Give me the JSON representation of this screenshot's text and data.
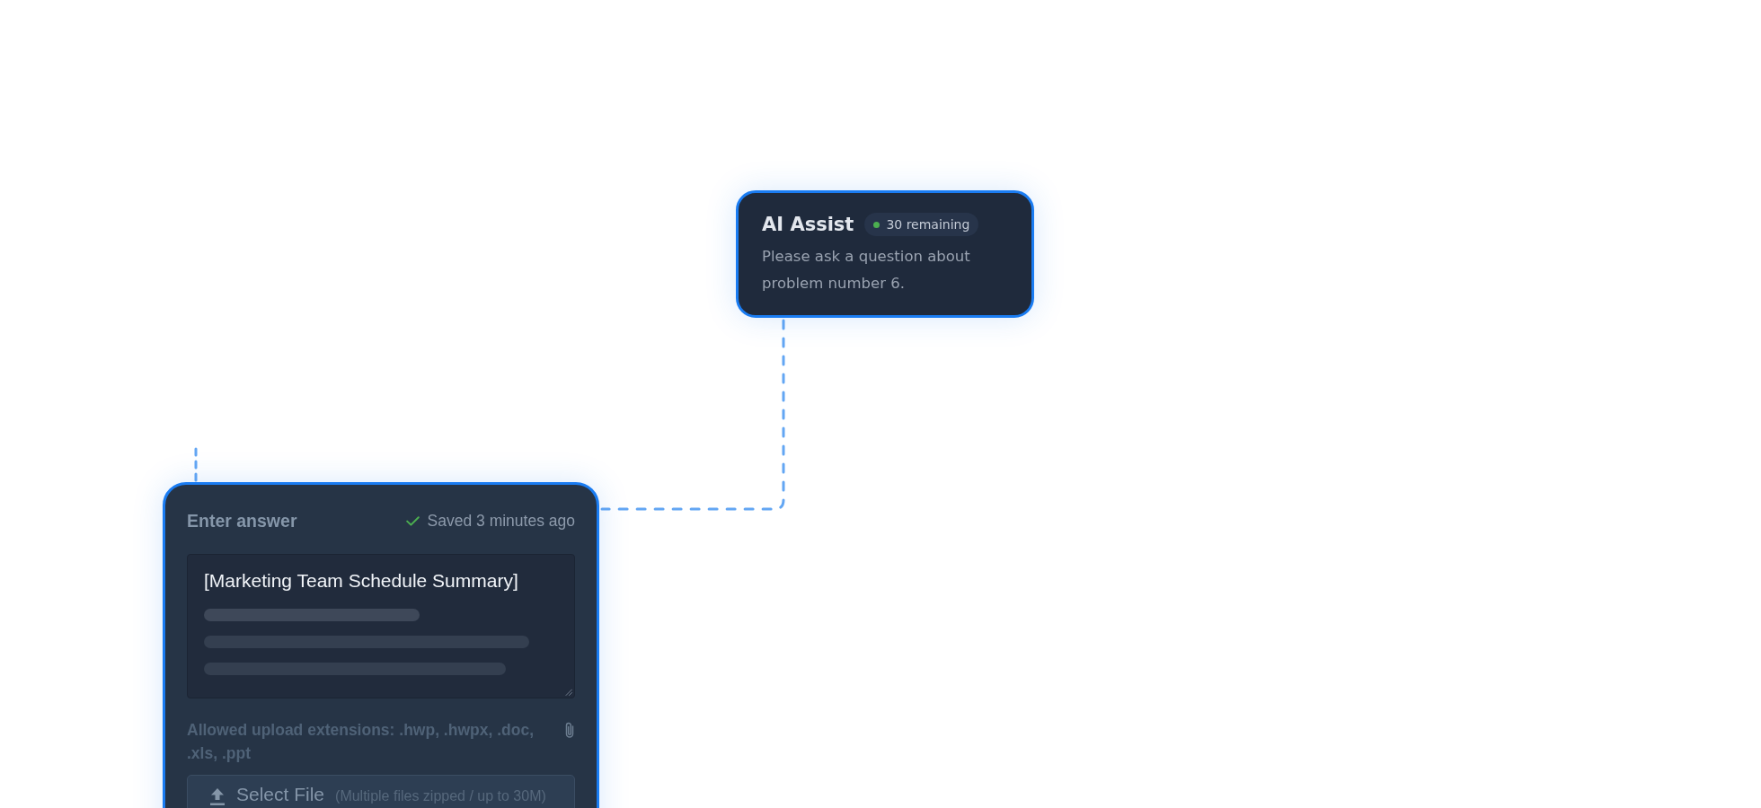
{
  "ai_assist": {
    "title": "AI Assist",
    "badge": {
      "text": "30 remaining",
      "active": true
    },
    "description": "Please ask a question about problem number 6."
  },
  "answer": {
    "title": "Enter answer",
    "save_status": "Saved 3 minutes ago",
    "value": "[Marketing Team Schedule Summary]",
    "allowed_extensions": "Allowed upload extensions: .hwp, .hwpx, .doc, .xls, .ppt",
    "upload_button": {
      "label": "Select File",
      "hint": "(Multiple files zipped / up to 30M)"
    }
  }
}
